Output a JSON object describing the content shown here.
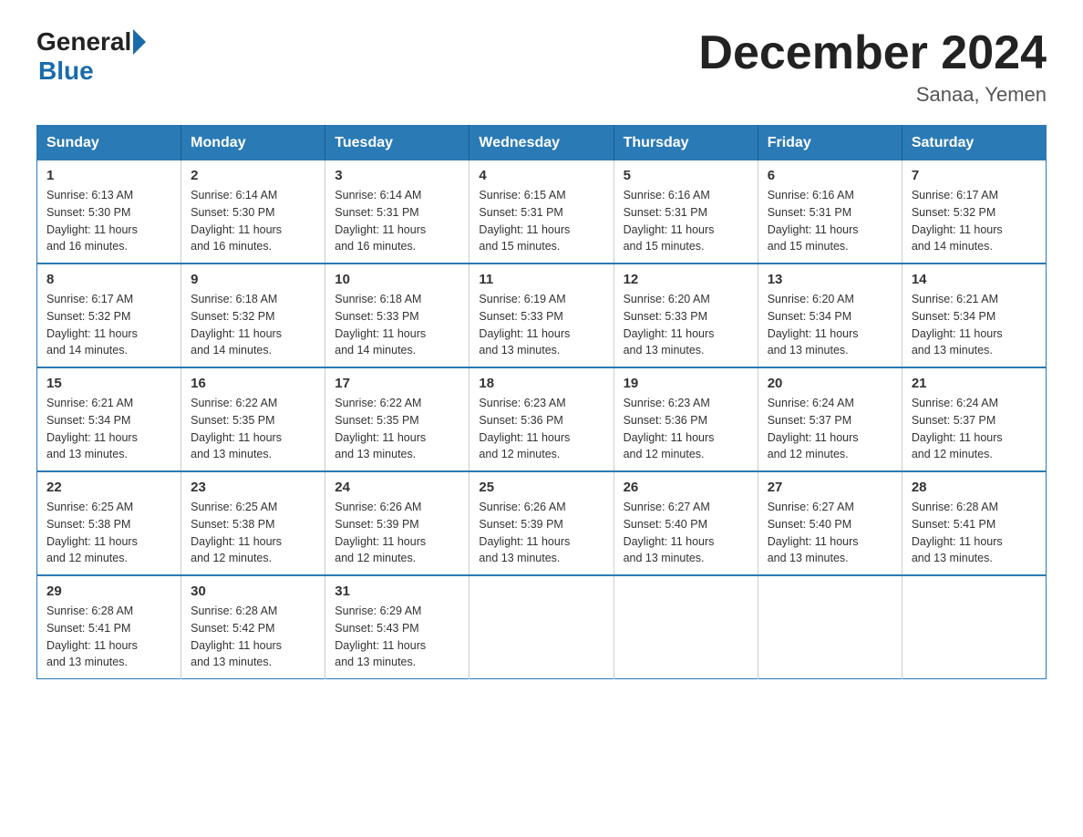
{
  "logo": {
    "general": "General",
    "blue": "Blue"
  },
  "title": "December 2024",
  "subtitle": "Sanaa, Yemen",
  "headers": [
    "Sunday",
    "Monday",
    "Tuesday",
    "Wednesday",
    "Thursday",
    "Friday",
    "Saturday"
  ],
  "weeks": [
    [
      {
        "day": "1",
        "info": "Sunrise: 6:13 AM\nSunset: 5:30 PM\nDaylight: 11 hours\nand 16 minutes."
      },
      {
        "day": "2",
        "info": "Sunrise: 6:14 AM\nSunset: 5:30 PM\nDaylight: 11 hours\nand 16 minutes."
      },
      {
        "day": "3",
        "info": "Sunrise: 6:14 AM\nSunset: 5:31 PM\nDaylight: 11 hours\nand 16 minutes."
      },
      {
        "day": "4",
        "info": "Sunrise: 6:15 AM\nSunset: 5:31 PM\nDaylight: 11 hours\nand 15 minutes."
      },
      {
        "day": "5",
        "info": "Sunrise: 6:16 AM\nSunset: 5:31 PM\nDaylight: 11 hours\nand 15 minutes."
      },
      {
        "day": "6",
        "info": "Sunrise: 6:16 AM\nSunset: 5:31 PM\nDaylight: 11 hours\nand 15 minutes."
      },
      {
        "day": "7",
        "info": "Sunrise: 6:17 AM\nSunset: 5:32 PM\nDaylight: 11 hours\nand 14 minutes."
      }
    ],
    [
      {
        "day": "8",
        "info": "Sunrise: 6:17 AM\nSunset: 5:32 PM\nDaylight: 11 hours\nand 14 minutes."
      },
      {
        "day": "9",
        "info": "Sunrise: 6:18 AM\nSunset: 5:32 PM\nDaylight: 11 hours\nand 14 minutes."
      },
      {
        "day": "10",
        "info": "Sunrise: 6:18 AM\nSunset: 5:33 PM\nDaylight: 11 hours\nand 14 minutes."
      },
      {
        "day": "11",
        "info": "Sunrise: 6:19 AM\nSunset: 5:33 PM\nDaylight: 11 hours\nand 13 minutes."
      },
      {
        "day": "12",
        "info": "Sunrise: 6:20 AM\nSunset: 5:33 PM\nDaylight: 11 hours\nand 13 minutes."
      },
      {
        "day": "13",
        "info": "Sunrise: 6:20 AM\nSunset: 5:34 PM\nDaylight: 11 hours\nand 13 minutes."
      },
      {
        "day": "14",
        "info": "Sunrise: 6:21 AM\nSunset: 5:34 PM\nDaylight: 11 hours\nand 13 minutes."
      }
    ],
    [
      {
        "day": "15",
        "info": "Sunrise: 6:21 AM\nSunset: 5:34 PM\nDaylight: 11 hours\nand 13 minutes."
      },
      {
        "day": "16",
        "info": "Sunrise: 6:22 AM\nSunset: 5:35 PM\nDaylight: 11 hours\nand 13 minutes."
      },
      {
        "day": "17",
        "info": "Sunrise: 6:22 AM\nSunset: 5:35 PM\nDaylight: 11 hours\nand 13 minutes."
      },
      {
        "day": "18",
        "info": "Sunrise: 6:23 AM\nSunset: 5:36 PM\nDaylight: 11 hours\nand 12 minutes."
      },
      {
        "day": "19",
        "info": "Sunrise: 6:23 AM\nSunset: 5:36 PM\nDaylight: 11 hours\nand 12 minutes."
      },
      {
        "day": "20",
        "info": "Sunrise: 6:24 AM\nSunset: 5:37 PM\nDaylight: 11 hours\nand 12 minutes."
      },
      {
        "day": "21",
        "info": "Sunrise: 6:24 AM\nSunset: 5:37 PM\nDaylight: 11 hours\nand 12 minutes."
      }
    ],
    [
      {
        "day": "22",
        "info": "Sunrise: 6:25 AM\nSunset: 5:38 PM\nDaylight: 11 hours\nand 12 minutes."
      },
      {
        "day": "23",
        "info": "Sunrise: 6:25 AM\nSunset: 5:38 PM\nDaylight: 11 hours\nand 12 minutes."
      },
      {
        "day": "24",
        "info": "Sunrise: 6:26 AM\nSunset: 5:39 PM\nDaylight: 11 hours\nand 12 minutes."
      },
      {
        "day": "25",
        "info": "Sunrise: 6:26 AM\nSunset: 5:39 PM\nDaylight: 11 hours\nand 13 minutes."
      },
      {
        "day": "26",
        "info": "Sunrise: 6:27 AM\nSunset: 5:40 PM\nDaylight: 11 hours\nand 13 minutes."
      },
      {
        "day": "27",
        "info": "Sunrise: 6:27 AM\nSunset: 5:40 PM\nDaylight: 11 hours\nand 13 minutes."
      },
      {
        "day": "28",
        "info": "Sunrise: 6:28 AM\nSunset: 5:41 PM\nDaylight: 11 hours\nand 13 minutes."
      }
    ],
    [
      {
        "day": "29",
        "info": "Sunrise: 6:28 AM\nSunset: 5:41 PM\nDaylight: 11 hours\nand 13 minutes."
      },
      {
        "day": "30",
        "info": "Sunrise: 6:28 AM\nSunset: 5:42 PM\nDaylight: 11 hours\nand 13 minutes."
      },
      {
        "day": "31",
        "info": "Sunrise: 6:29 AM\nSunset: 5:43 PM\nDaylight: 11 hours\nand 13 minutes."
      },
      {
        "day": "",
        "info": ""
      },
      {
        "day": "",
        "info": ""
      },
      {
        "day": "",
        "info": ""
      },
      {
        "day": "",
        "info": ""
      }
    ]
  ]
}
